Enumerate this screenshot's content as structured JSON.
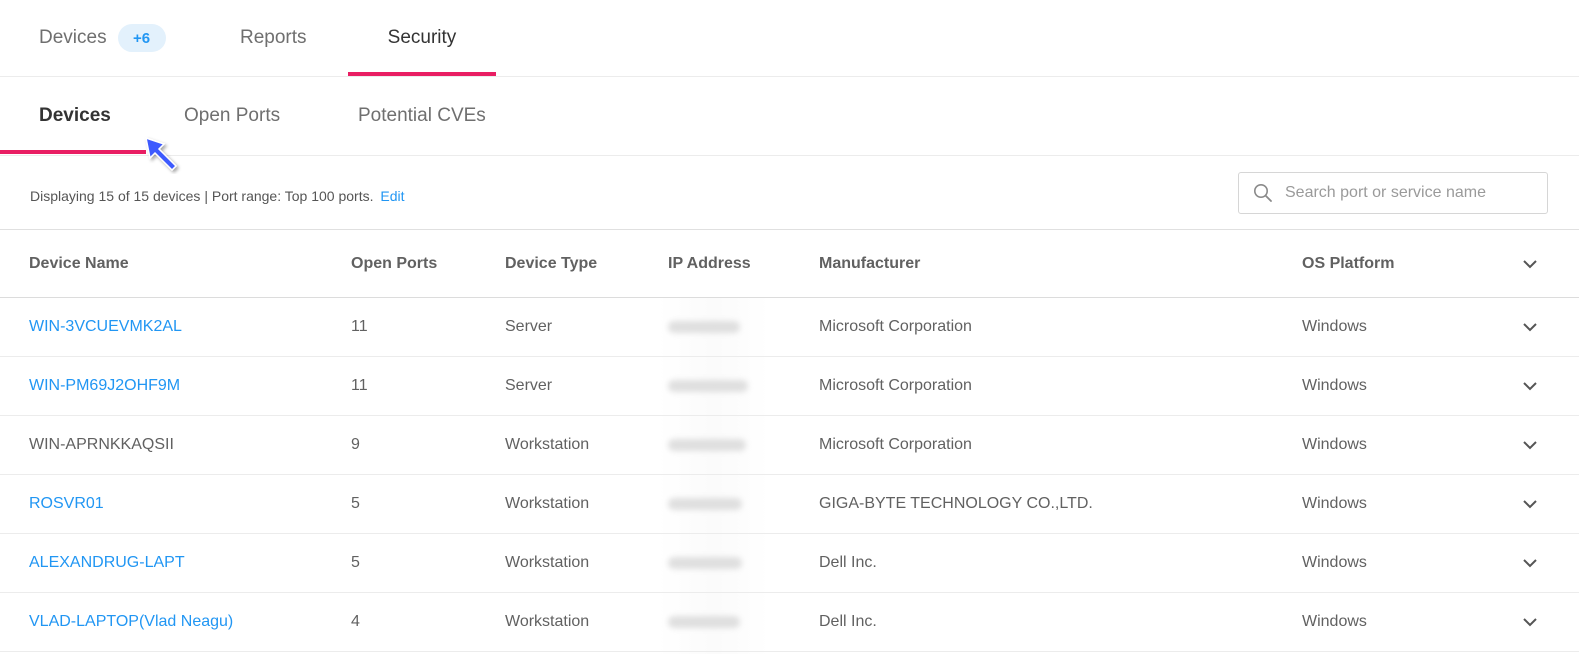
{
  "top_tabs": [
    {
      "label": "Devices",
      "badge": "+6"
    },
    {
      "label": "Reports"
    },
    {
      "label": "Security",
      "active": true
    }
  ],
  "sub_tabs": [
    {
      "label": "Devices",
      "active": true
    },
    {
      "label": "Open Ports"
    },
    {
      "label": "Potential CVEs"
    }
  ],
  "info": {
    "text": "Displaying 15 of 15 devices | Port range: Top 100 ports.",
    "edit_label": "Edit"
  },
  "search": {
    "placeholder": "Search port or service name",
    "value": "",
    "icon": "search-icon"
  },
  "table": {
    "headers": [
      "Device Name",
      "Open Ports",
      "Device Type",
      "IP Address",
      "Manufacturer",
      "OS Platform"
    ],
    "rows": [
      {
        "name": "WIN-3VCUEVMK2AL",
        "link": true,
        "ports": "11",
        "type": "Server",
        "manufacturer": "Microsoft Corporation",
        "os": "Windows"
      },
      {
        "name": "WIN-PM69J2OHF9M",
        "link": true,
        "ports": "11",
        "type": "Server",
        "manufacturer": "Microsoft Corporation",
        "os": "Windows"
      },
      {
        "name": "WIN-APRNKKAQSII",
        "link": false,
        "ports": "9",
        "type": "Workstation",
        "manufacturer": "Microsoft Corporation",
        "os": "Windows"
      },
      {
        "name": "ROSVR01",
        "link": true,
        "ports": "5",
        "type": "Workstation",
        "manufacturer": "GIGA-BYTE TECHNOLOGY CO.,LTD.",
        "os": "Windows"
      },
      {
        "name": "ALEXANDRUG-LAPT",
        "link": true,
        "ports": "5",
        "type": "Workstation",
        "manufacturer": "Dell Inc.",
        "os": "Windows"
      },
      {
        "name": "VLAD-LAPTOP(Vlad Neagu)",
        "link": true,
        "ports": "4",
        "type": "Workstation",
        "manufacturer": "Dell Inc.",
        "os": "Windows"
      }
    ]
  },
  "colors": {
    "accent": "#e91e63",
    "link": "#2196f3",
    "cursor": "#3d5afe"
  }
}
